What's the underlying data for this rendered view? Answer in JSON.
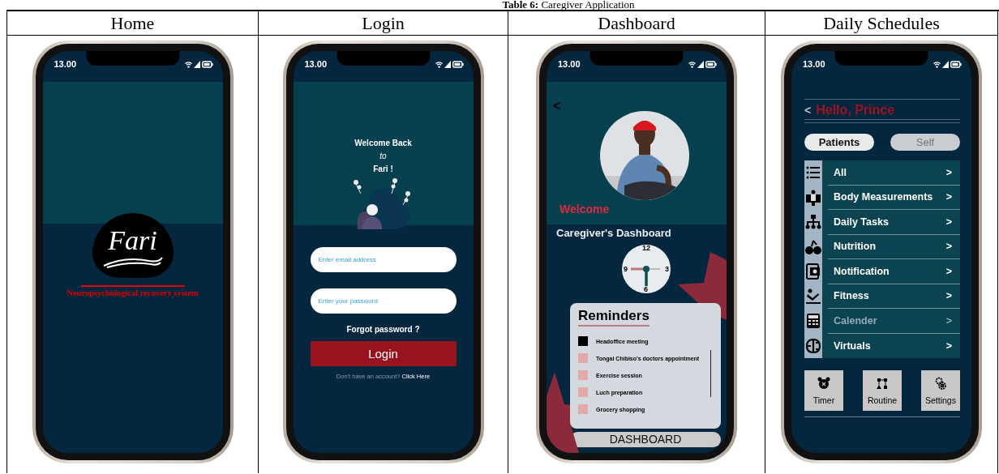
{
  "caption": "**Table 6:** Caregiver Application",
  "columns": [
    {
      "heading": "Home",
      "screen": {
        "kind": "home",
        "status_time": "13.00",
        "logo_text": "Fari",
        "tagline": "Neuropsychological recovery system"
      }
    },
    {
      "heading": "Login",
      "screen": {
        "kind": "login",
        "status_time": "13.00",
        "greeting": [
          "Welcome Back",
          "to",
          "Fari !"
        ],
        "email_placeholder": "Enter email address",
        "password_placeholder": "Enter your password",
        "forgot": "Forgot password ?",
        "login_button": "Login",
        "signup_prompt": "Don't have an account?",
        "signup_link": "Click Here"
      }
    },
    {
      "heading": "Dashboard",
      "screen": {
        "kind": "dashboard",
        "status_time": "13.00",
        "back": "<",
        "welcome": "Welcome",
        "title": "Caregiver's Dashboard",
        "clock_numbers": [
          "12",
          "3",
          "6",
          "9"
        ],
        "reminders_title": "Reminders",
        "reminders": [
          {
            "text": "Headoffice meeting",
            "checked": true
          },
          {
            "text": "Tongai Chibiso's doctors appointment",
            "checked": false
          },
          {
            "text": "Exercise session",
            "checked": false
          },
          {
            "text": "Luch preparation",
            "checked": false
          },
          {
            "text": "Grocery shopping",
            "checked": false
          }
        ],
        "bottom_button": "DASHBOARD"
      }
    },
    {
      "heading": "Daily Schedules",
      "screen": {
        "kind": "schedules",
        "status_time": "13.00",
        "back": "<",
        "greeting": "Hello, Prince",
        "tabs": [
          {
            "label": "Patients",
            "selected": true
          },
          {
            "label": "Self",
            "selected": false
          }
        ],
        "menu": [
          {
            "label": "All",
            "chevron": ">",
            "disabled": false
          },
          {
            "label": "Body Measurements",
            "chevron": ">",
            "disabled": false
          },
          {
            "label": "Daily Tasks",
            "chevron": ">",
            "disabled": false
          },
          {
            "label": "Nutrition",
            "chevron": ">",
            "disabled": false
          },
          {
            "label": "Notification",
            "chevron": ">",
            "disabled": false
          },
          {
            "label": "Fitness",
            "chevron": ">",
            "disabled": false
          },
          {
            "label": "Calender",
            "chevron": ">",
            "disabled": true
          },
          {
            "label": "Virtuals",
            "chevron": ">",
            "disabled": false
          }
        ],
        "tools": [
          {
            "label": "Timer"
          },
          {
            "label": "Routine"
          },
          {
            "label": "Settings"
          }
        ]
      }
    }
  ]
}
